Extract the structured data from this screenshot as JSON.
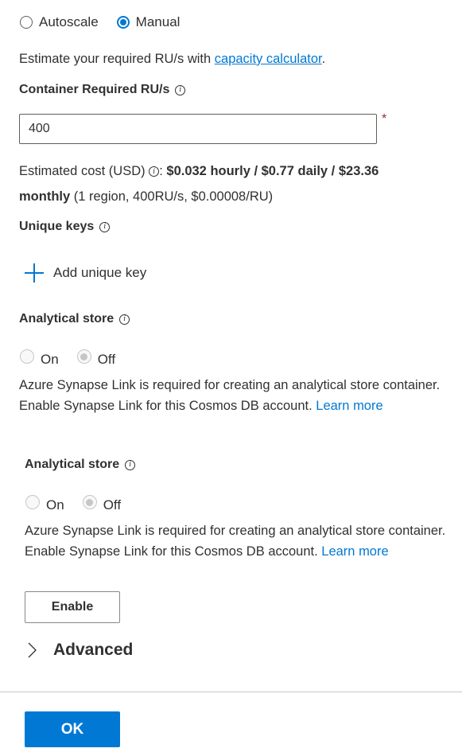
{
  "throughput": {
    "mode_options": [
      {
        "label": "Autoscale",
        "checked": false
      },
      {
        "label": "Manual",
        "checked": true
      }
    ],
    "estimate_prefix": "Estimate your required RU/s with ",
    "estimate_link": "capacity calculator",
    "estimate_suffix": ".",
    "required_label": "Container Required RU/s",
    "required_value": "400",
    "required_marker": "*",
    "cost_prefix": "Estimated cost (USD) ",
    "cost_colon": ":",
    "cost_bold_1": " $0.032 hourly / $0.77 daily / $23.36",
    "cost_bold_2": "monthly",
    "cost_detail": " (1 region, 400RU/s, $0.00008/RU)"
  },
  "unique_keys": {
    "label": "Unique keys",
    "add_label": "Add unique key"
  },
  "analytical_store_1": {
    "label": "Analytical store",
    "options": [
      {
        "label": "On",
        "checked": false
      },
      {
        "label": "Off",
        "checked": true
      }
    ],
    "message": "Azure Synapse Link is required for creating an analytical store container. Enable Synapse Link for this Cosmos DB account. ",
    "link": "Learn more"
  },
  "analytical_store_2": {
    "label": "Analytical store",
    "options": [
      {
        "label": "On",
        "checked": false
      },
      {
        "label": "Off",
        "checked": true
      }
    ],
    "message": "Azure Synapse Link is required for creating an analytical store container. Enable Synapse Link for this Cosmos DB account. ",
    "link": "Learn more",
    "enable_button": "Enable"
  },
  "advanced": {
    "label": "Advanced"
  },
  "footer": {
    "ok_button": "OK"
  },
  "info_glyph": "i",
  "colors": {
    "accent": "#0078d4",
    "required": "#a4262c"
  }
}
